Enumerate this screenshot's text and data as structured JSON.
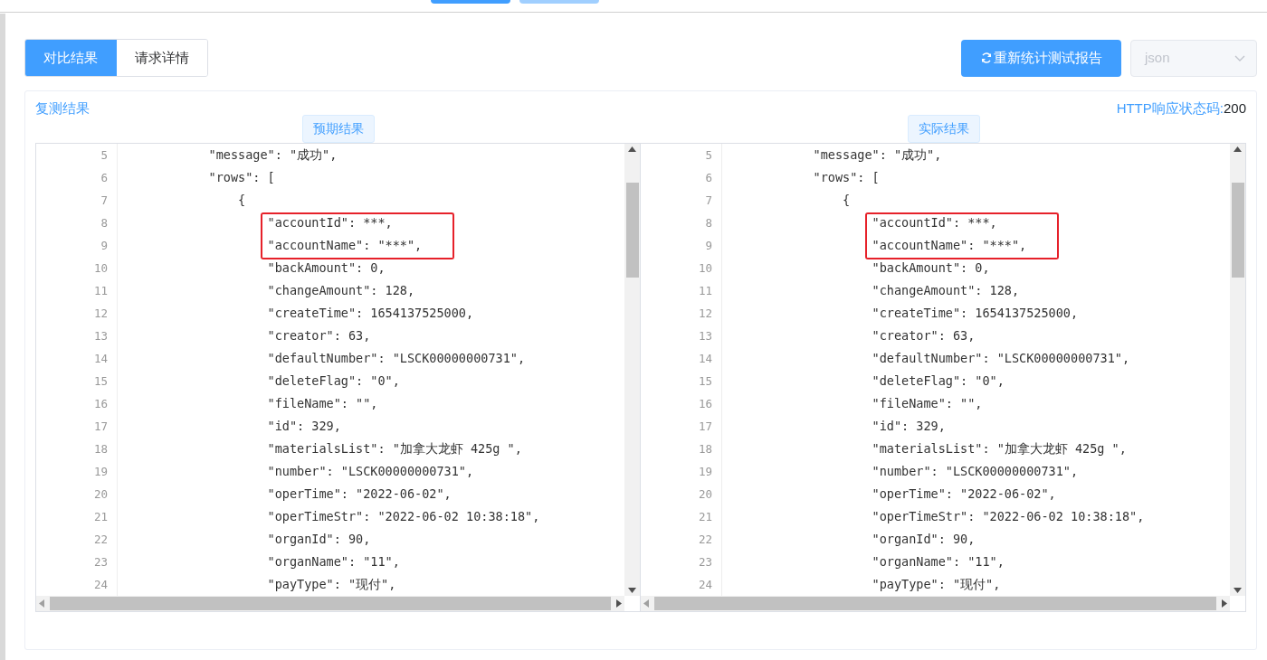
{
  "top_buttons": [
    {
      "disabled": false
    },
    {
      "disabled": true
    }
  ],
  "tabs": [
    {
      "label": "对比结果",
      "selected": true
    },
    {
      "label": "请求详情",
      "selected": false
    }
  ],
  "recount_button": {
    "label": "重新统计测试报告"
  },
  "format_select": {
    "value": "json",
    "disabled": true
  },
  "result_panel": {
    "title": "复测结果",
    "status_label": "HTTP响应状态码:",
    "status_value": "200",
    "panes": [
      {
        "title": "预期结果",
        "lines": [
          {
            "number": "5",
            "text": "            \"message\": \"成功\",",
            "highlighted": false
          },
          {
            "number": "6",
            "text": "            \"rows\": [",
            "highlighted": false
          },
          {
            "number": "7",
            "text": "                {",
            "highlighted": false
          },
          {
            "number": "8",
            "text": "                    \"accountId\": ***,",
            "highlighted": true
          },
          {
            "number": "9",
            "text": "                    \"accountName\": \"***\",",
            "highlighted": true
          },
          {
            "number": "10",
            "text": "                    \"backAmount\": 0,",
            "highlighted": false
          },
          {
            "number": "11",
            "text": "                    \"changeAmount\": 128,",
            "highlighted": false
          },
          {
            "number": "12",
            "text": "                    \"createTime\": 1654137525000,",
            "highlighted": false
          },
          {
            "number": "13",
            "text": "                    \"creator\": 63,",
            "highlighted": false
          },
          {
            "number": "14",
            "text": "                    \"defaultNumber\": \"LSCK00000000731\",",
            "highlighted": false
          },
          {
            "number": "15",
            "text": "                    \"deleteFlag\": \"0\",",
            "highlighted": false
          },
          {
            "number": "16",
            "text": "                    \"fileName\": \"\",",
            "highlighted": false
          },
          {
            "number": "17",
            "text": "                    \"id\": 329,",
            "highlighted": false
          },
          {
            "number": "18",
            "text": "                    \"materialsList\": \"加拿大龙虾 425g \",",
            "highlighted": false
          },
          {
            "number": "19",
            "text": "                    \"number\": \"LSCK00000000731\",",
            "highlighted": false
          },
          {
            "number": "20",
            "text": "                    \"operTime\": \"2022-06-02\",",
            "highlighted": false
          },
          {
            "number": "21",
            "text": "                    \"operTimeStr\": \"2022-06-02 10:38:18\",",
            "highlighted": false
          },
          {
            "number": "22",
            "text": "                    \"organId\": 90,",
            "highlighted": false
          },
          {
            "number": "23",
            "text": "                    \"organName\": \"11\",",
            "highlighted": false
          },
          {
            "number": "24",
            "text": "                    \"payType\": \"现付\",",
            "highlighted": false
          }
        ]
      },
      {
        "title": "实际结果",
        "lines": [
          {
            "number": "5",
            "text": "            \"message\": \"成功\",",
            "highlighted": false
          },
          {
            "number": "6",
            "text": "            \"rows\": [",
            "highlighted": false
          },
          {
            "number": "7",
            "text": "                {",
            "highlighted": false
          },
          {
            "number": "8",
            "text": "                    \"accountId\": ***,",
            "highlighted": true
          },
          {
            "number": "9",
            "text": "                    \"accountName\": \"***\",",
            "highlighted": true
          },
          {
            "number": "10",
            "text": "                    \"backAmount\": 0,",
            "highlighted": false
          },
          {
            "number": "11",
            "text": "                    \"changeAmount\": 128,",
            "highlighted": false
          },
          {
            "number": "12",
            "text": "                    \"createTime\": 1654137525000,",
            "highlighted": false
          },
          {
            "number": "13",
            "text": "                    \"creator\": 63,",
            "highlighted": false
          },
          {
            "number": "14",
            "text": "                    \"defaultNumber\": \"LSCK00000000731\",",
            "highlighted": false
          },
          {
            "number": "15",
            "text": "                    \"deleteFlag\": \"0\",",
            "highlighted": false
          },
          {
            "number": "16",
            "text": "                    \"fileName\": \"\",",
            "highlighted": false
          },
          {
            "number": "17",
            "text": "                    \"id\": 329,",
            "highlighted": false
          },
          {
            "number": "18",
            "text": "                    \"materialsList\": \"加拿大龙虾 425g \",",
            "highlighted": false
          },
          {
            "number": "19",
            "text": "                    \"number\": \"LSCK00000000731\",",
            "highlighted": false
          },
          {
            "number": "20",
            "text": "                    \"operTime\": \"2022-06-02\",",
            "highlighted": false
          },
          {
            "number": "21",
            "text": "                    \"operTimeStr\": \"2022-06-02 10:38:18\",",
            "highlighted": false
          },
          {
            "number": "22",
            "text": "                    \"organId\": 90,",
            "highlighted": false
          },
          {
            "number": "23",
            "text": "                    \"organName\": \"11\",",
            "highlighted": false
          },
          {
            "number": "24",
            "text": "                    \"payType\": \"现付\",",
            "highlighted": false
          }
        ]
      }
    ]
  }
}
